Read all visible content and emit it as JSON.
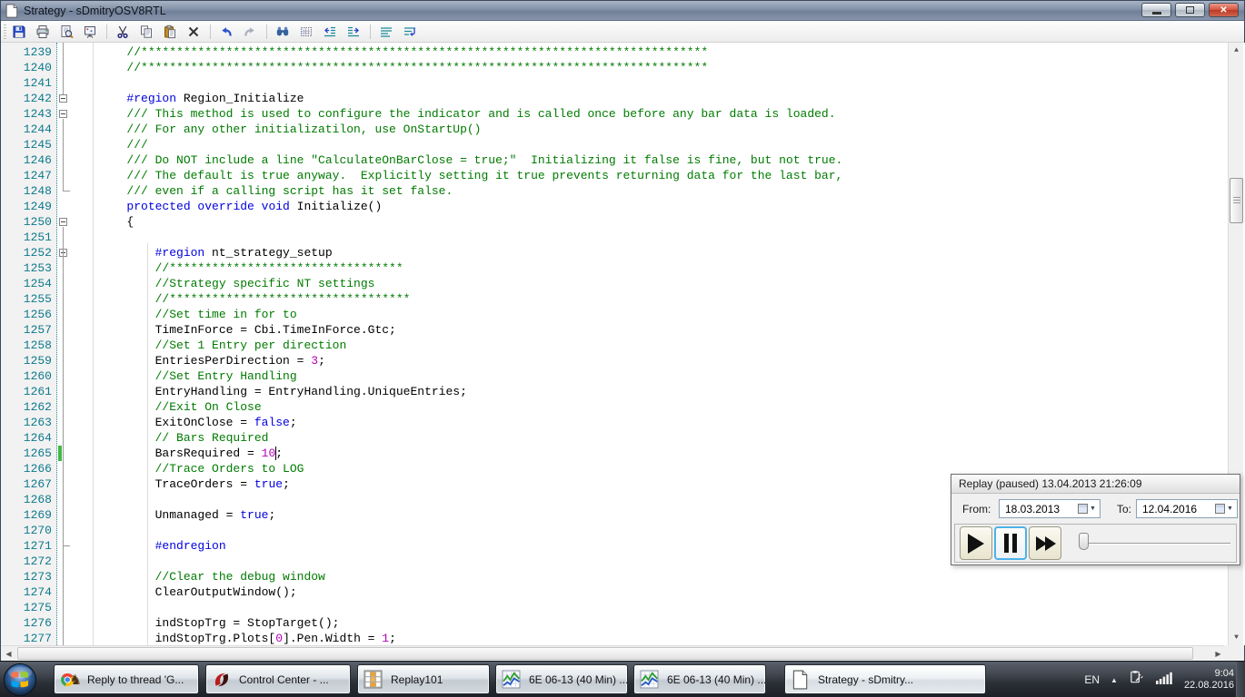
{
  "window": {
    "title": "Strategy - sDmitryOSV8RTL",
    "controls": [
      "minimize",
      "restore",
      "close"
    ]
  },
  "toolbar": {
    "items": [
      "save",
      "print",
      "print-preview",
      "design-board",
      "|",
      "cut",
      "copy",
      "paste",
      "delete",
      "|",
      "undo",
      "redo",
      "|",
      "find",
      "grid-panel",
      "outdent",
      "indent",
      "|",
      "align-lines",
      "word-wrap"
    ]
  },
  "editor": {
    "changed_line": 1265,
    "caret": {
      "line": 1265,
      "col": 29
    },
    "fold_connectors": [
      {
        "from": "top",
        "to": 1242
      },
      {
        "from": 1243,
        "to": 1248,
        "tick": true
      },
      {
        "from": 1250,
        "to": 1277,
        "tick": false
      },
      {
        "from": 1252,
        "to": 1271,
        "tick": true
      }
    ],
    "lines": [
      {
        "n": 1239,
        "segs": [
          [
            "c",
            "        //********************************************************************************"
          ]
        ]
      },
      {
        "n": 1240,
        "segs": [
          [
            "c",
            "        //********************************************************************************"
          ]
        ]
      },
      {
        "n": 1241,
        "segs": []
      },
      {
        "n": 1242,
        "fold": "box",
        "segs": [
          [
            "p",
            "        "
          ],
          [
            "k",
            "#region"
          ],
          [
            "p",
            " Region_Initialize"
          ]
        ]
      },
      {
        "n": 1243,
        "fold": "box",
        "segs": [
          [
            "c",
            "        /// This method is used to configure the indicator and is called once before any bar data is loaded."
          ]
        ]
      },
      {
        "n": 1244,
        "segs": [
          [
            "c",
            "        /// For any other initializatilon, use OnStartUp()"
          ]
        ]
      },
      {
        "n": 1245,
        "segs": [
          [
            "c",
            "        ///"
          ]
        ]
      },
      {
        "n": 1246,
        "segs": [
          [
            "c",
            "        /// Do NOT include a line \"CalculateOnBarClose = true;\"  Initializing it false is fine, but not true."
          ]
        ]
      },
      {
        "n": 1247,
        "segs": [
          [
            "c",
            "        /// The default is true anyway.  Explicitly setting it true prevents returning data for the last bar,"
          ]
        ]
      },
      {
        "n": 1248,
        "segs": [
          [
            "c",
            "        /// even if a calling script has it set false."
          ]
        ]
      },
      {
        "n": 1249,
        "segs": [
          [
            "p",
            "        "
          ],
          [
            "k",
            "protected override void"
          ],
          [
            "p",
            " Initialize()"
          ]
        ]
      },
      {
        "n": 1250,
        "fold": "box",
        "segs": [
          [
            "p",
            "        {"
          ]
        ]
      },
      {
        "n": 1251,
        "segs": []
      },
      {
        "n": 1252,
        "fold": "box",
        "segs": [
          [
            "p",
            "            "
          ],
          [
            "k",
            "#region"
          ],
          [
            "p",
            " nt_strategy_setup"
          ]
        ]
      },
      {
        "n": 1253,
        "segs": [
          [
            "c",
            "            //*********************************"
          ]
        ]
      },
      {
        "n": 1254,
        "segs": [
          [
            "c",
            "            //Strategy specific NT settings"
          ]
        ]
      },
      {
        "n": 1255,
        "segs": [
          [
            "c",
            "            //**********************************"
          ]
        ]
      },
      {
        "n": 1256,
        "segs": [
          [
            "c",
            "            //Set time in for to"
          ]
        ]
      },
      {
        "n": 1257,
        "segs": [
          [
            "p",
            "            TimeInForce = Cbi.TimeInForce.Gtc;"
          ]
        ]
      },
      {
        "n": 1258,
        "segs": [
          [
            "c",
            "            //Set 1 Entry per direction"
          ]
        ]
      },
      {
        "n": 1259,
        "segs": [
          [
            "p",
            "            EntriesPerDirection = "
          ],
          [
            "n",
            "3"
          ],
          [
            "p",
            ";"
          ]
        ]
      },
      {
        "n": 1260,
        "segs": [
          [
            "c",
            "            //Set Entry Handling"
          ]
        ]
      },
      {
        "n": 1261,
        "segs": [
          [
            "p",
            "            EntryHandling = EntryHandling.UniqueEntries;"
          ]
        ]
      },
      {
        "n": 1262,
        "segs": [
          [
            "c",
            "            //Exit On Close"
          ]
        ]
      },
      {
        "n": 1263,
        "segs": [
          [
            "p",
            "            ExitOnClose = "
          ],
          [
            "k",
            "false"
          ],
          [
            "p",
            ";"
          ]
        ]
      },
      {
        "n": 1264,
        "segs": [
          [
            "c",
            "            // Bars Required"
          ]
        ]
      },
      {
        "n": 1265,
        "segs": [
          [
            "p",
            "            BarsRequired = "
          ],
          [
            "n",
            "10"
          ],
          [
            "p",
            ";"
          ]
        ]
      },
      {
        "n": 1266,
        "segs": [
          [
            "c",
            "            //Trace Orders to LOG"
          ]
        ]
      },
      {
        "n": 1267,
        "segs": [
          [
            "p",
            "            TraceOrders = "
          ],
          [
            "k",
            "true"
          ],
          [
            "p",
            ";"
          ]
        ]
      },
      {
        "n": 1268,
        "segs": []
      },
      {
        "n": 1269,
        "segs": [
          [
            "p",
            "            Unmanaged = "
          ],
          [
            "k",
            "true"
          ],
          [
            "p",
            ";"
          ]
        ]
      },
      {
        "n": 1270,
        "segs": []
      },
      {
        "n": 1271,
        "segs": [
          [
            "p",
            "            "
          ],
          [
            "k",
            "#endregion"
          ]
        ]
      },
      {
        "n": 1272,
        "segs": []
      },
      {
        "n": 1273,
        "segs": [
          [
            "c",
            "            //Clear the debug window"
          ]
        ]
      },
      {
        "n": 1274,
        "segs": [
          [
            "p",
            "            ClearOutputWindow();"
          ]
        ]
      },
      {
        "n": 1275,
        "segs": []
      },
      {
        "n": 1276,
        "segs": [
          [
            "p",
            "            indStopTrg = StopTarget();"
          ]
        ]
      },
      {
        "n": 1277,
        "segs": [
          [
            "p",
            "            indStopTrg.Plots["
          ],
          [
            "n",
            "0"
          ],
          [
            "p",
            "].Pen.Width = "
          ],
          [
            "n",
            "1"
          ],
          [
            "p",
            ";"
          ]
        ]
      }
    ]
  },
  "replay": {
    "title": "Replay (paused) 13.04.2013 21:26:09",
    "from_label": "From:",
    "from_value": "18.03.2013",
    "to_label": "To:",
    "to_value": "12.04.2016",
    "buttons": [
      "play",
      "pause",
      "fast-forward"
    ],
    "active_button": "pause"
  },
  "taskbar": {
    "items": [
      {
        "icon": "chrome-knight",
        "label": "Reply to thread 'G..."
      },
      {
        "icon": "ninjatrader",
        "label": "Control Center - ..."
      },
      {
        "icon": "replay-grid",
        "label": "Replay101"
      },
      {
        "icon": "chart",
        "label": "6E 06-13 (40 Min) ..."
      },
      {
        "icon": "chart",
        "label": "6E 06-13 (40 Min) ..."
      },
      {
        "icon": "document",
        "label": "Strategy - sDmitry...",
        "active": true
      }
    ],
    "tray": {
      "lang": "EN",
      "time": "9:04",
      "date": "22.08.2016"
    }
  },
  "colors": {
    "keyword": "#0000e0",
    "comment": "#007b00",
    "number": "#b400b4",
    "line_number": "#0d7a8c",
    "changed_bar": "#43b843",
    "titlebar": "#8291a8",
    "replay_active_border": "#4db2e8",
    "taskbar": "#2b2f36"
  }
}
